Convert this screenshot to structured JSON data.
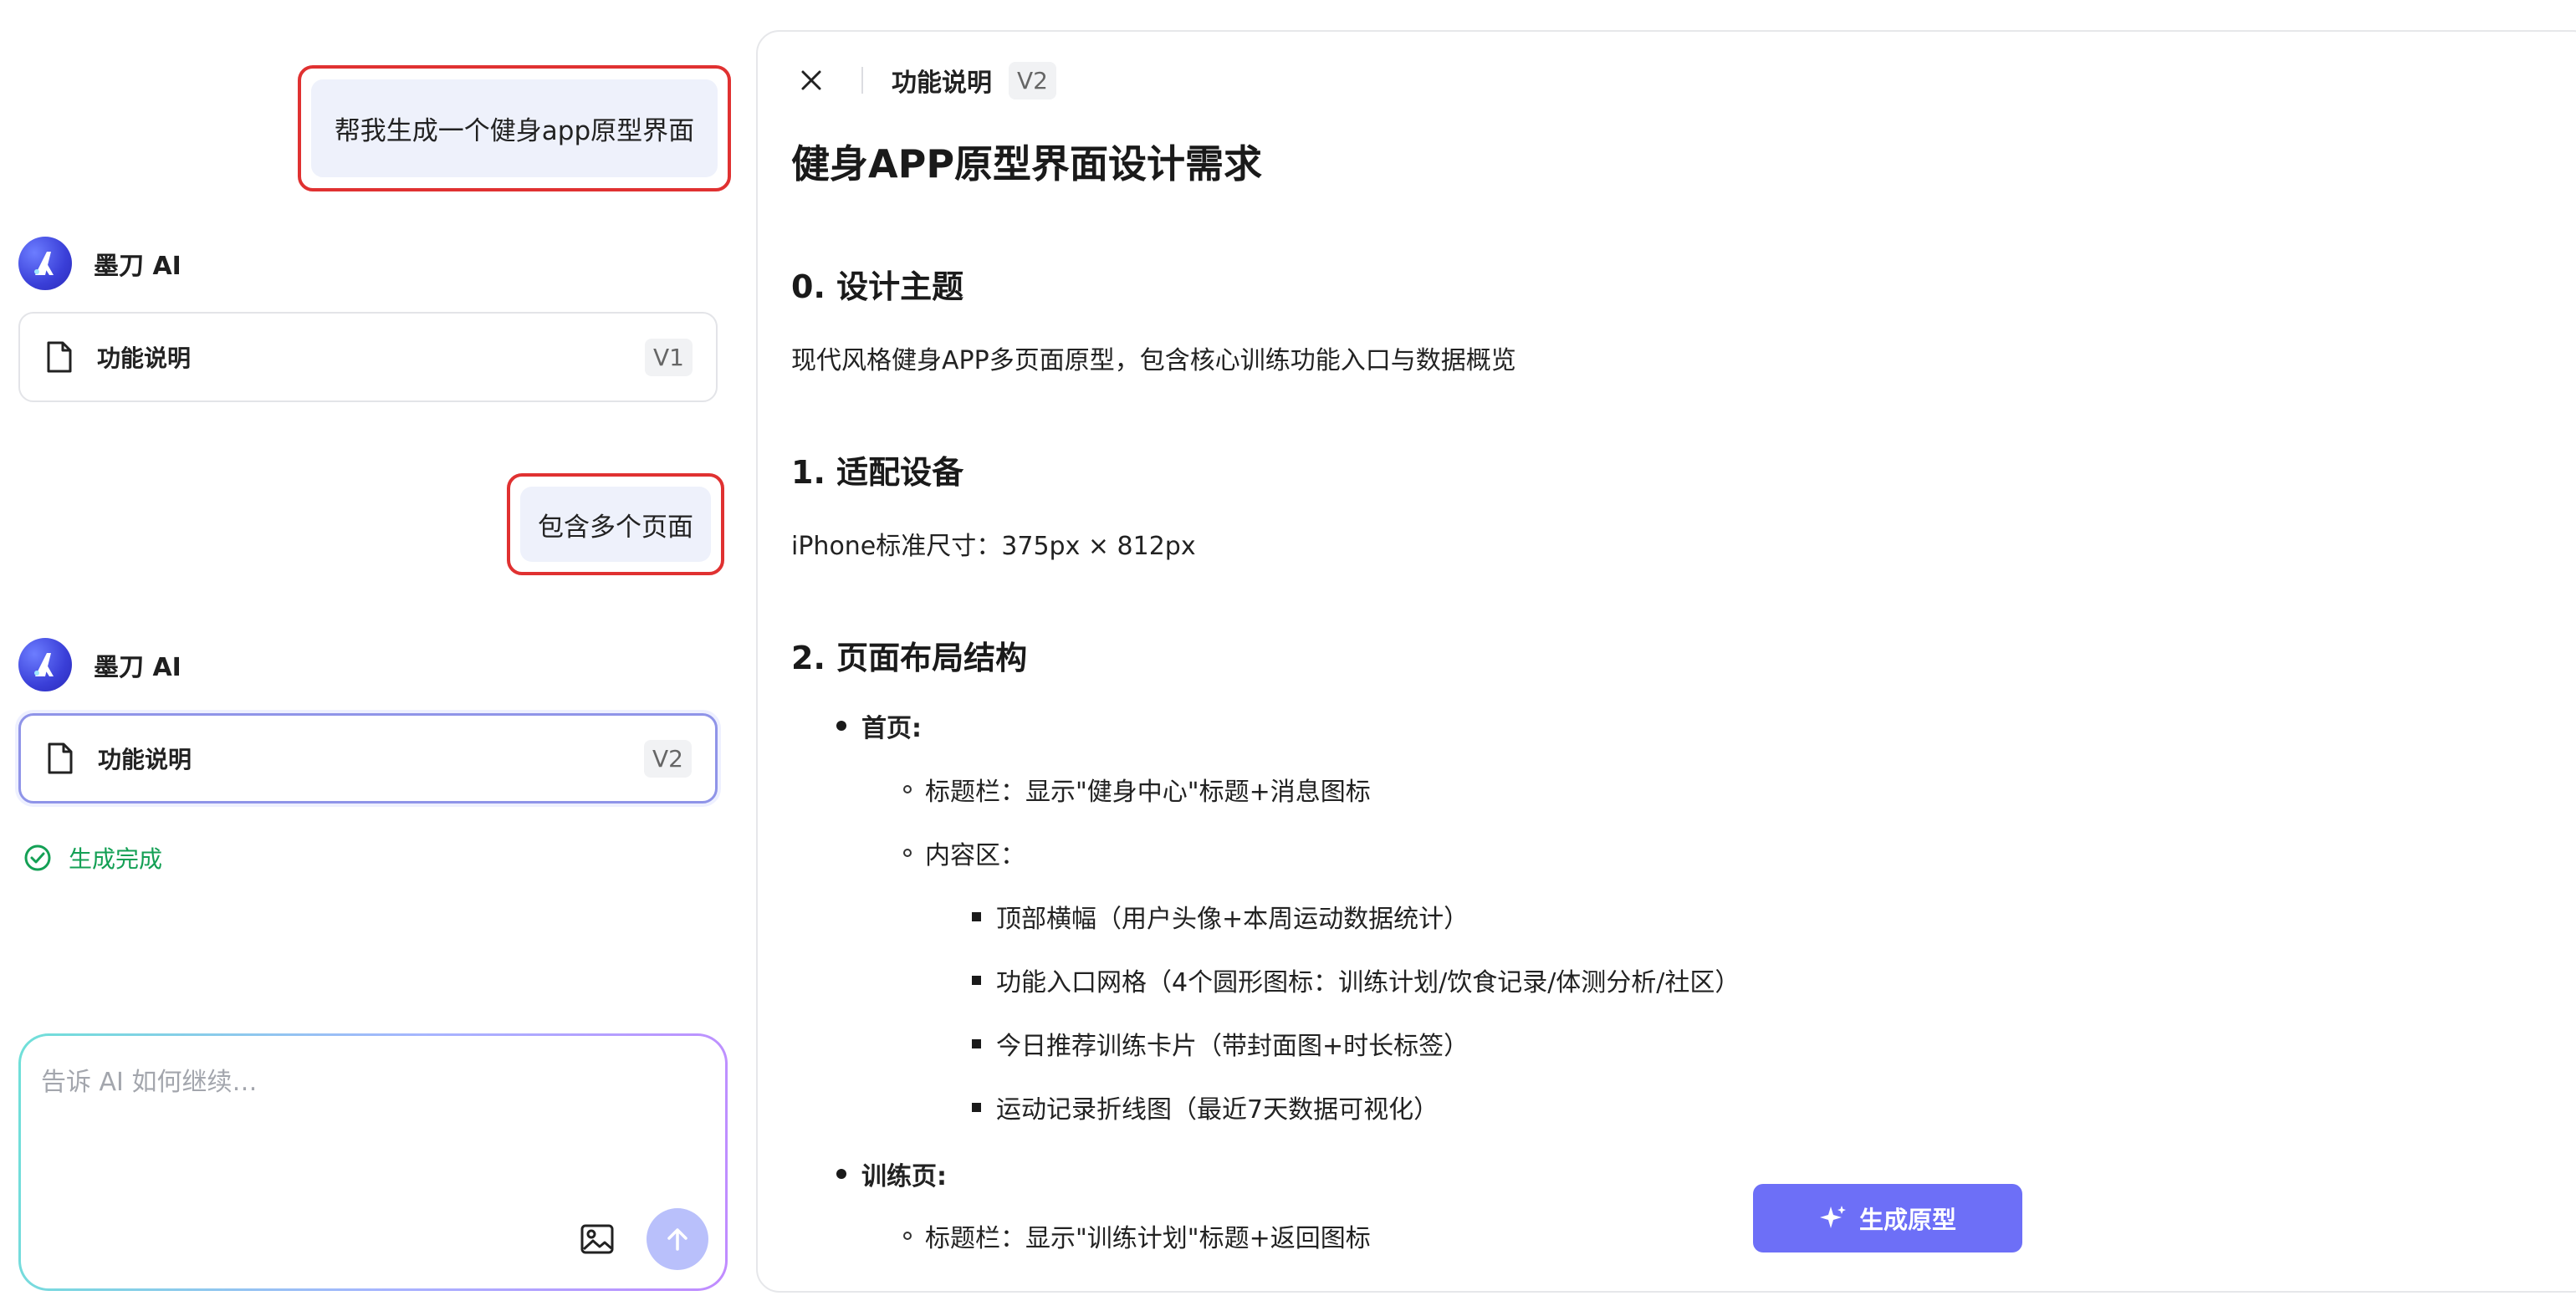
{
  "chat": {
    "messages": [
      {
        "role": "user",
        "text": "帮我生成一个健身app原型界面"
      },
      {
        "role": "ai",
        "name": "墨刀 AI",
        "card": {
          "label": "功能说明",
          "version": "V1"
        }
      },
      {
        "role": "user",
        "text": "包含多个页面"
      },
      {
        "role": "ai",
        "name": "墨刀 AI",
        "card": {
          "label": "功能说明",
          "version": "V2"
        },
        "status": "生成完成"
      }
    ],
    "composer": {
      "placeholder": "告诉 AI 如何继续…"
    }
  },
  "doc": {
    "header": {
      "title": "功能说明",
      "version": "V2"
    },
    "title": "健身APP原型界面设计需求",
    "sections": [
      {
        "heading": "0. 设计主题",
        "text": "现代风格健身APP多页面原型，包含核心训练功能入口与数据概览"
      },
      {
        "heading": "1. 适配设备",
        "text": "iPhone标准尺寸：375px × 812px"
      },
      {
        "heading": "2. 页面布局结构"
      }
    ],
    "outline": {
      "home": {
        "label": "首页:",
        "titlebar": "标题栏：显示\"健身中心\"标题+消息图标",
        "content": "内容区：",
        "items": [
          "顶部横幅（用户头像+本周运动数据统计）",
          "功能入口网格（4个圆形图标：训练计划/饮食记录/体测分析/社区）",
          "今日推荐训练卡片（带封面图+时长标签）",
          "运动记录折线图（最近7天数据可视化）"
        ]
      },
      "training": {
        "label": "训练页:",
        "titlebar": "标题栏：显示\"训练计划\"标题+返回图标"
      }
    },
    "action": {
      "generate_label": "生成原型"
    }
  },
  "colors": {
    "accent": "#6d6ff7",
    "highlight_border": "#e03131",
    "success": "#14a055"
  }
}
